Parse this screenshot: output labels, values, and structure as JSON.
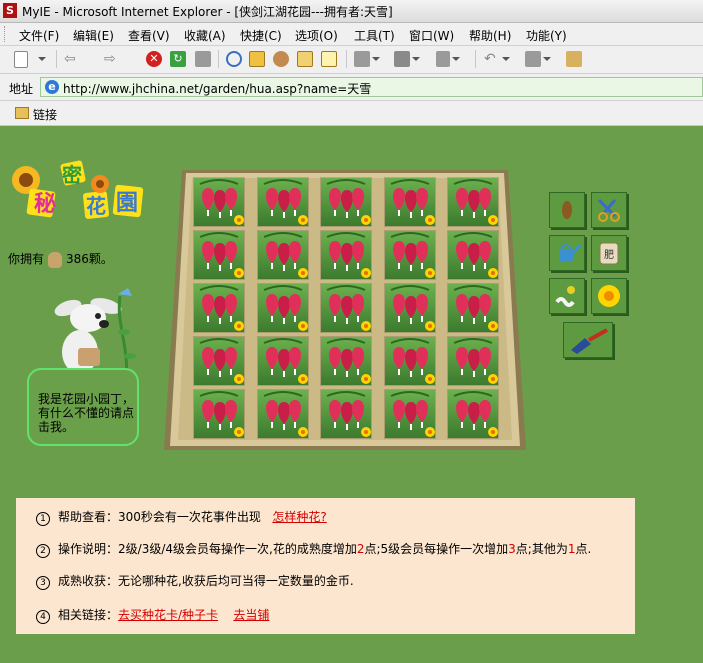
{
  "window": {
    "title": "MyIE - Microsoft Internet Explorer - [侠剑江湖花园---拥有者:天雪]"
  },
  "menu": [
    "文件(F)",
    "编辑(E)",
    "查看(V)",
    "收藏(A)",
    "快捷(C)",
    "选项(O)",
    "工具(T)",
    "窗口(W)",
    "帮助(H)",
    "功能(Y)"
  ],
  "address": {
    "label": "地址",
    "url": "http://www.jhchina.net/garden/hua.asp?name=天雪"
  },
  "links": {
    "label": "链接"
  },
  "garden": {
    "logo_text": [
      "秘",
      "密",
      "花",
      "園"
    ],
    "owned_prefix": "你拥有",
    "owned_value": "386颗。",
    "speech": "我是花园小园丁，有什么不懂的请点击我。",
    "tools": [
      "seed-icon",
      "scissors-icon",
      "watering-can-icon",
      "fertilizer-bag-icon",
      "pest-icon",
      "sunflower-icon",
      "trowel-icon"
    ],
    "grid": {
      "rows": 5,
      "cols": 5
    },
    "tool_labels": {
      "fertilizer": "肥"
    }
  },
  "info": {
    "row1": {
      "num": "1",
      "label": "帮助查看：",
      "text": "300秒会有一次花事件出现",
      "link": "怎样种花?"
    },
    "row2": {
      "num": "2",
      "label": "操作说明：",
      "p1": "2级/3级/4级会员每操作一次,花的成熟度增加",
      "n1": "2",
      "p2": "点;5级会员每操作一次增加",
      "n2": "3",
      "p3": "点;其他为",
      "n3": "1",
      "p4": "点."
    },
    "row3": {
      "num": "3",
      "label": "成熟收获：",
      "text": "无论哪种花,收获后均可当得一定数量的金币."
    },
    "row4": {
      "num": "4",
      "label": "相关链接：",
      "link1": "去买种花卡/种子卡",
      "link2": "去当铺"
    }
  }
}
